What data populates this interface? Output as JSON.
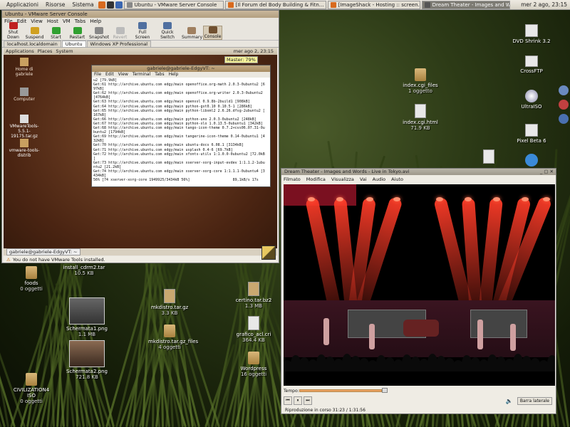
{
  "top_panel": {
    "menus": [
      "Applicazioni",
      "Risorse",
      "Sistema"
    ],
    "tasks": [
      {
        "label": "Ubuntu - VMware Server Console"
      },
      {
        "label": "[Il Forum del Body Building & Fitn..."
      },
      {
        "label": "[ImageShack - Hosting :: screen..."
      },
      {
        "label": "Dream Theater - Images and Wo..."
      }
    ],
    "clock": "mer 2 ago, 23:15"
  },
  "desktop_icons": [
    {
      "label": "DVD Shrink 3.2",
      "sub": ""
    },
    {
      "label": "CrossFTP",
      "sub": ""
    },
    {
      "label": "UltraISO",
      "sub": ""
    },
    {
      "label": "Pixel Beta 6",
      "sub": ""
    },
    {
      "label": "index.cgi_files",
      "sub": "1 oggetto"
    },
    {
      "label": "index.cgi.html",
      "sub": "71.9 KB"
    },
    {
      "label": "install_cdrm2.tar",
      "sub": "10.5 KB"
    },
    {
      "label": "foods",
      "sub": "0 oggetti"
    },
    {
      "label": "Schermata1.png",
      "sub": "1.1 MB"
    },
    {
      "label": "Schermata2.png",
      "sub": "721.8 KB"
    },
    {
      "label": "mkdistro.tar.gz",
      "sub": "3.3 KB"
    },
    {
      "label": "mkdistro.tar.gz_files",
      "sub": "4 oggetti"
    },
    {
      "label": "certino.tar.bz2",
      "sub": "1.3 MB"
    },
    {
      "label": "grafico_acl.cri",
      "sub": "364.4 KB"
    },
    {
      "label": "Wordpress",
      "sub": "16 oggetti"
    },
    {
      "label": "CIVILIZATION4 ISO",
      "sub": "0 oggetti"
    }
  ],
  "vmware": {
    "title": "Ubuntu - VMware Server Console",
    "menu": [
      "File",
      "Edit",
      "View",
      "Host",
      "VM",
      "Tabs",
      "Help"
    ],
    "toolbar": [
      "Shut Down",
      "Suspend",
      "Start",
      "Restart",
      "Snapshot",
      "Revert",
      "Full Screen",
      "Quick Switch",
      "Summary",
      "Console"
    ],
    "tabs": [
      "localhost.localdomain",
      "Ubuntu",
      "Windows XP Professional"
    ],
    "guest_panel": [
      "Applications",
      "Places",
      "System"
    ],
    "guest_clock": "mer ago 2, 23:15",
    "master_badge": "Master: 79%",
    "guest_icons": [
      {
        "label": "Home di gabriele"
      },
      {
        "label": "Computer"
      },
      {
        "label": "VMwareTools-5.5.1-19175.tar.gz"
      },
      {
        "label": "vmware-tools-distrib"
      }
    ],
    "guest_taskbar": "gabriele@gabriele-EdgyVT: ~",
    "status": "You do not have VMware Tools installed."
  },
  "terminal": {
    "title": "gabriele@gabriele-EdgyVT: ~",
    "menu": [
      "File",
      "Edit",
      "View",
      "Terminal",
      "Tabs",
      "Help"
    ],
    "lines": [
      "u2 [79.9kB]",
      "Get:61 http://archive.ubuntu.com edgy/main openoffice.org-math 2.0.3-0ubuntu2 [6",
      "97kB]",
      "Get:62 http://archive.ubuntu.com edgy/main openoffice.org-writer 2.0.3-0ubuntu2",
      "[4764kB]",
      "Get:63 http://archive.ubuntu.com edgy/main openssl 0.9.8b-2build1 [908kB]",
      "Get:64 http://archive.ubuntu.com edgy/main python-gst0.10 0.10.5-1 [286kB]",
      "Get:65 http://archive.ubuntu.com edgy/main python-libxml2 2.6.26.dfsg-2ubuntu2 [",
      "167kB]",
      "Get:66 http://archive.ubuntu.com edgy/main python-uno 2.0.3-0ubuntu2 [248kB]",
      "Get:67 http://archive.ubuntu.com edgy/main python-xlo 1.0.13.5-0ubuntu1 [342kB]",
      "Get:68 http://archive.ubuntu.com edgy/main tango-icon-theme 0.7.2+cvs06.07.31-0u",
      "buntu2 [1794kB]",
      "Get:69 http://archive.ubuntu.com edgy/main tangerine-icon-theme 0.14-0ubuntu1 [4",
      "32kB]",
      "Get:70 http://archive.ubuntu.com edgy/main ubuntu-docs 6.08.1 [3134kB]",
      "Get:71 http://archive.ubuntu.com edgy/main usplash 0.4-6 [69.7kB]",
      "Get:72 http://archive.ubuntu.com edgy/main xfonts-utils 1:1.0.0-0ubuntu2 [72.0kB",
      "]",
      "Get:73 http://archive.ubuntu.com edgy/main xserver-xorg-input-evdev 1:1.1.2-1ubu",
      "ntu2 [21.2kB]",
      "Get:74 http://archive.ubuntu.com edgy/main xserver-xorg-core 1:1.1.1-0ubuntu4 [3",
      "434kB]",
      "56% [74 xserver-xorg-core 1949925/3434kB 56%]                    89,1kB/s 17s"
    ]
  },
  "totem": {
    "title": "Dream Theater - Images and Words - Live in Tokyo.avi",
    "menu": [
      "Filmato",
      "Modifica",
      "Visualizza",
      "Vai",
      "Audio",
      "Aiuto"
    ],
    "tempo_label": "Tempo:",
    "progress": 0.34,
    "playlist_label": "Barra laterale",
    "status": "Riproduzione in corso  31:23 / 1:31:56",
    "volume_icon": "speaker-icon"
  }
}
